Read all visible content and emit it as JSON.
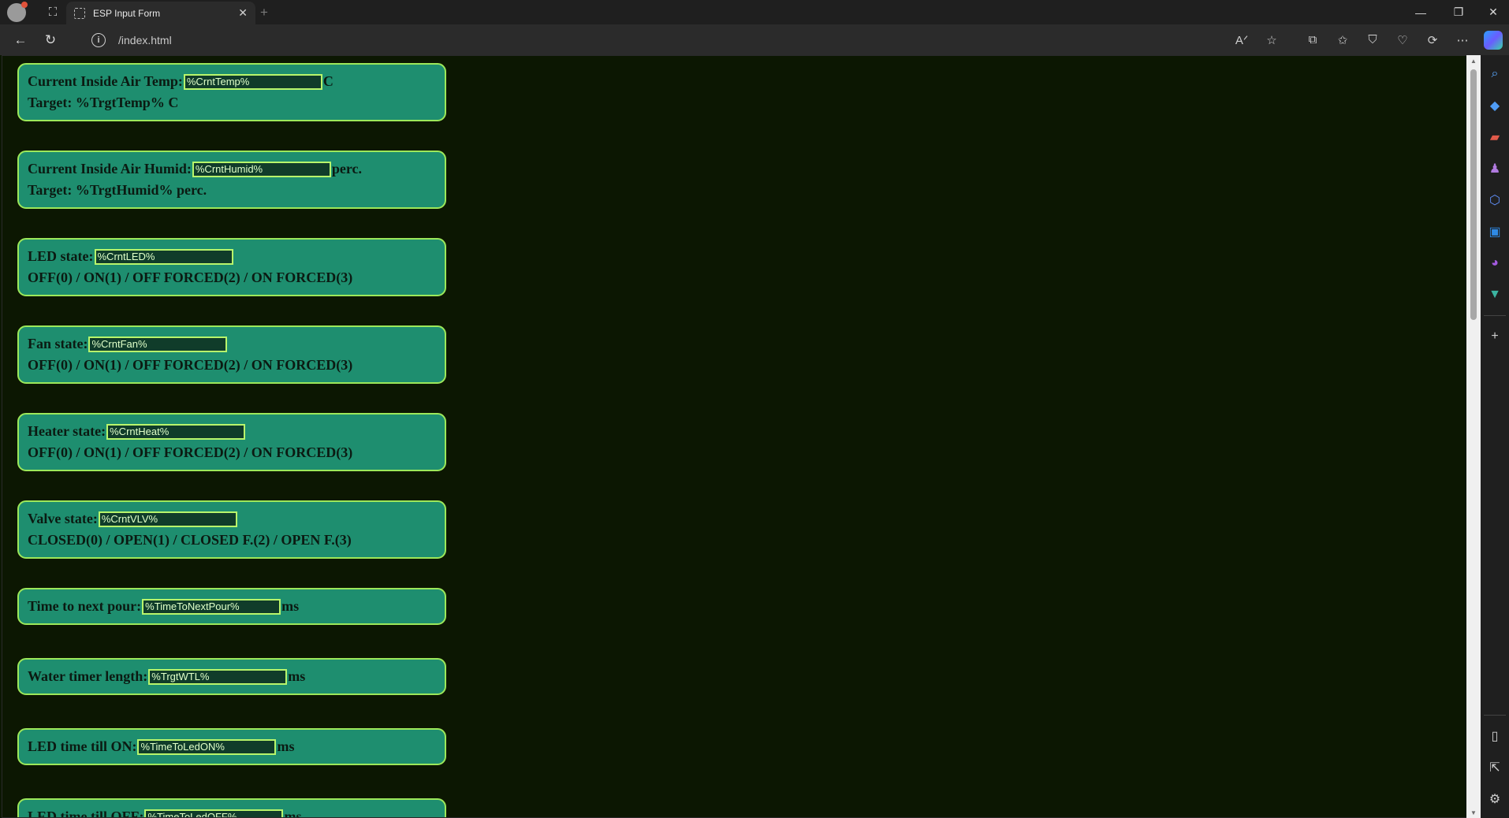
{
  "browser": {
    "tab_title": "ESP Input Form",
    "tab_close": "✕",
    "new_tab": "+",
    "address": "/index.html",
    "info_icon_glyph": "i"
  },
  "cards": [
    {
      "label": "Current Inside Air Temp:",
      "value": "%CrntTemp%",
      "unit": "C",
      "second": "Target: %TrgtTemp% C"
    },
    {
      "label": "Current Inside Air Humid:",
      "value": "%CrntHumid%",
      "unit": "perc.",
      "second": "Target: %TrgtHumid% perc."
    },
    {
      "label": "LED state:",
      "value": "%CrntLED%",
      "unit": "",
      "second": "OFF(0) / ON(1) / OFF FORCED(2) / ON FORCED(3)"
    },
    {
      "label": "Fan state:",
      "value": "%CrntFan%",
      "unit": "",
      "second": "OFF(0) / ON(1) / OFF FORCED(2) / ON FORCED(3)"
    },
    {
      "label": "Heater state:",
      "value": "%CrntHeat%",
      "unit": "",
      "second": "OFF(0) / ON(1) / OFF FORCED(2) / ON FORCED(3)"
    },
    {
      "label": "Valve state:",
      "value": "%CrntVLV%",
      "unit": "",
      "second": "CLOSED(0) / OPEN(1) / CLOSED F.(2) / OPEN F.(3)"
    },
    {
      "label": "Time to next pour:",
      "value": "%TimeToNextPour%",
      "unit": "ms"
    },
    {
      "label": "Water timer length:",
      "value": "%TrgtWTL%",
      "unit": "ms"
    },
    {
      "label": "LED time till ON:",
      "value": "%TimeToLedON%",
      "unit": "ms"
    },
    {
      "label": "LED time till OFF:",
      "value": "%TimeToLedOFF%",
      "unit": "ms"
    }
  ],
  "colors": {
    "page_bg": "#0c1702",
    "card_bg": "#1e8e6f",
    "card_border": "#9ce85a",
    "field_bg": "#103c2a",
    "field_border": "#b8f56b"
  }
}
